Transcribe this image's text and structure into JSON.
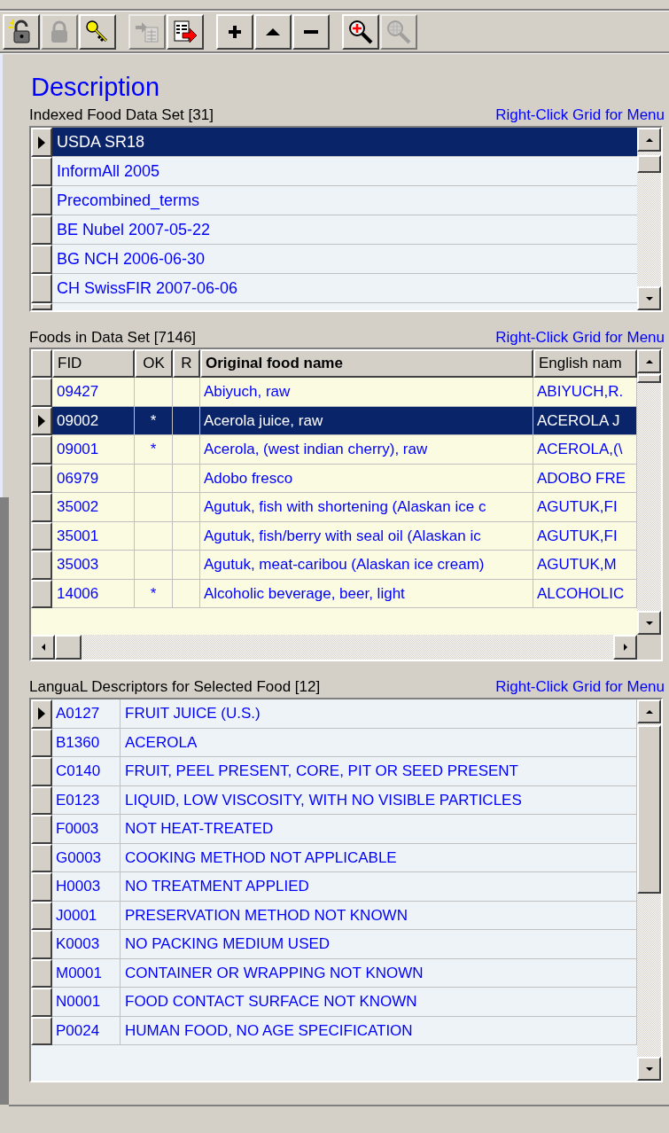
{
  "toolbar": [
    {
      "kind": "unlock",
      "disabled": false
    },
    {
      "kind": "lock",
      "disabled": true
    },
    {
      "kind": "key",
      "disabled": false
    },
    {
      "kind": "import",
      "disabled": true
    },
    {
      "kind": "export",
      "disabled": false
    },
    {
      "kind": "add",
      "disabled": false
    },
    {
      "kind": "up",
      "disabled": false
    },
    {
      "kind": "remove",
      "disabled": false
    },
    {
      "kind": "zoom_in",
      "disabled": false
    },
    {
      "kind": "zoom_out",
      "disabled": true
    }
  ],
  "title": "Description",
  "datasets": {
    "label": "Indexed Food Data Set [31]",
    "hint": "Right-Click Grid for Menu",
    "rows": [
      {
        "name": "USDA SR18",
        "selected": true,
        "current": true
      },
      {
        "name": "InformAll 2005",
        "selected": false,
        "current": false
      },
      {
        "name": "Precombined_terms",
        "selected": false,
        "current": false
      },
      {
        "name": "BE Nubel 2007-05-22",
        "selected": false,
        "current": false
      },
      {
        "name": "BG NCH 2006-06-30",
        "selected": false,
        "current": false
      },
      {
        "name": "CH SwissFIR 2007-06-06",
        "selected": false,
        "current": false
      }
    ]
  },
  "foods": {
    "label": "Foods in Data Set [7146]",
    "hint": "Right-Click Grid for Menu",
    "columns": [
      "FID",
      "OK",
      "R",
      "Original food name",
      "English nam"
    ],
    "rows": [
      {
        "fid": "09427",
        "original": "Abiyuch, raw",
        "english": "ABIYUCH,R.",
        "selected": false,
        "current": false
      },
      {
        "fid": "09002",
        "ok": "*",
        "original": "Acerola juice, raw",
        "english": "ACEROLA J",
        "selected": true,
        "current": true
      },
      {
        "fid": "09001",
        "ok": "*",
        "original": "Acerola, (west indian cherry), raw",
        "english": "ACEROLA,(\\",
        "selected": false,
        "current": false
      },
      {
        "fid": "06979",
        "original": "Adobo fresco",
        "english": "ADOBO FRE",
        "selected": false,
        "current": false
      },
      {
        "fid": "35002",
        "original": "Agutuk, fish with shortening (Alaskan ice c",
        "english": "AGUTUK,FI",
        "selected": false,
        "current": false
      },
      {
        "fid": "35001",
        "original": "Agutuk, fish/berry with seal oil (Alaskan ic",
        "english": "AGUTUK,FI",
        "selected": false,
        "current": false
      },
      {
        "fid": "35003",
        "original": "Agutuk, meat-caribou (Alaskan ice cream)",
        "english": "AGUTUK,M",
        "selected": false,
        "current": false
      },
      {
        "fid": "14006",
        "ok": "*",
        "original": "Alcoholic beverage, beer, light",
        "english": "ALCOHOLIC",
        "selected": false,
        "current": false
      }
    ]
  },
  "descriptors": {
    "label": "LanguaL Descriptors for Selected Food [12]",
    "hint": "Right-Click Grid for Menu",
    "rows": [
      {
        "code": "A0127",
        "text": "FRUIT JUICE (U.S.)",
        "selected": false,
        "current": true
      },
      {
        "code": "B1360",
        "text": "ACEROLA",
        "selected": false,
        "current": false
      },
      {
        "code": "C0140",
        "text": "FRUIT, PEEL PRESENT, CORE, PIT OR SEED PRESENT",
        "selected": false,
        "current": false
      },
      {
        "code": "E0123",
        "text": "LIQUID, LOW VISCOSITY, WITH NO VISIBLE PARTICLES",
        "selected": false,
        "current": false
      },
      {
        "code": "F0003",
        "text": "NOT HEAT-TREATED",
        "selected": false,
        "current": false
      },
      {
        "code": "G0003",
        "text": "COOKING METHOD NOT APPLICABLE",
        "selected": false,
        "current": false
      },
      {
        "code": "H0003",
        "text": "NO TREATMENT APPLIED",
        "selected": false,
        "current": false
      },
      {
        "code": "J0001",
        "text": "PRESERVATION METHOD NOT KNOWN",
        "selected": false,
        "current": false
      },
      {
        "code": "K0003",
        "text": "NO PACKING MEDIUM USED",
        "selected": false,
        "current": false
      },
      {
        "code": "M0001",
        "text": "CONTAINER OR WRAPPING NOT KNOWN",
        "selected": false,
        "current": false
      },
      {
        "code": "N0001",
        "text": "FOOD CONTACT SURFACE NOT KNOWN",
        "selected": false,
        "current": false
      },
      {
        "code": "P0024",
        "text": "HUMAN FOOD, NO AGE SPECIFICATION",
        "selected": false,
        "current": false
      }
    ]
  }
}
